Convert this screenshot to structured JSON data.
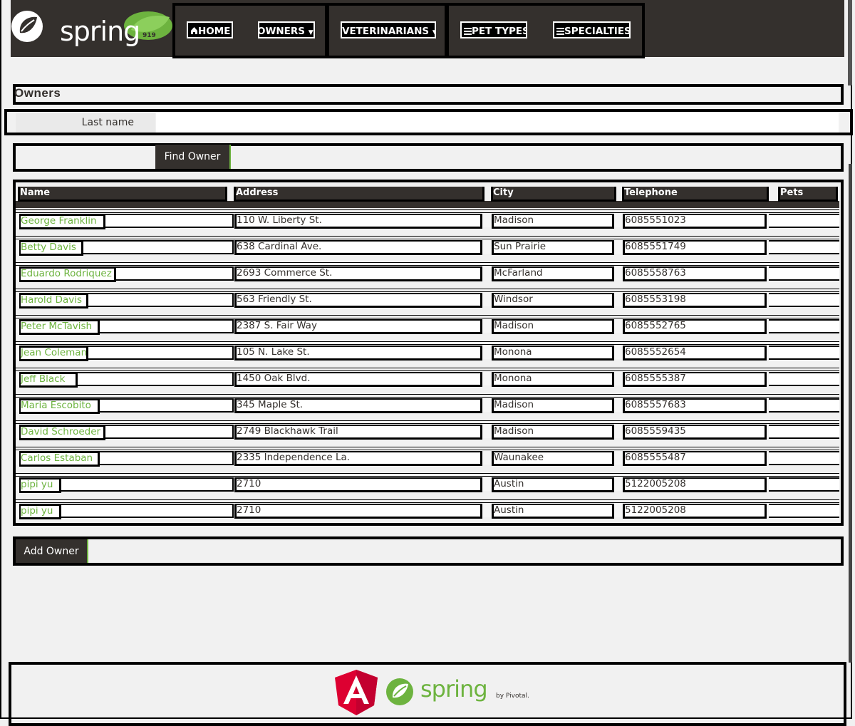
{
  "brand": {
    "name": "spring"
  },
  "nav": {
    "home": "HOME",
    "owners": "OWNERS",
    "veterinarians": "VETERINARIANS",
    "pet_types": "PET TYPES",
    "specialties": "SPECIALTIES"
  },
  "page": {
    "title": "Owners"
  },
  "search": {
    "label": "Last name",
    "value": "",
    "button": "Find Owner"
  },
  "table": {
    "headers": [
      "Name",
      "Address",
      "City",
      "Telephone",
      "Pets"
    ],
    "rows": [
      [
        "George Franklin",
        "110 W. Liberty St.",
        "Madison",
        "6085551023",
        ""
      ],
      [
        "Betty Davis",
        "638 Cardinal Ave.",
        "Sun Prairie",
        "6085551749",
        ""
      ],
      [
        "Eduardo Rodriquez",
        "2693 Commerce St.",
        "McFarland",
        "6085558763",
        ""
      ],
      [
        "Harold Davis",
        "563 Friendly St.",
        "Windsor",
        "6085553198",
        ""
      ],
      [
        "Peter McTavish",
        "2387 S. Fair Way",
        "Madison",
        "6085552765",
        ""
      ],
      [
        "Jean Coleman",
        "105 N. Lake St.",
        "Monona",
        "6085552654",
        ""
      ],
      [
        "Jeff Black",
        "1450 Oak Blvd.",
        "Monona",
        "6085555387",
        ""
      ],
      [
        "Maria Escobito",
        "345 Maple St.",
        "Madison",
        "6085557683",
        ""
      ],
      [
        "David Schroeder",
        "2749 Blackhawk Trail",
        "Madison",
        "6085559435",
        ""
      ],
      [
        "Carlos Estaban",
        "2335 Independence La.",
        "Waunakee",
        "6085555487",
        ""
      ],
      [
        "pipi yu",
        "2710",
        "Austin",
        "5122005208",
        ""
      ],
      [
        "pipi yu",
        "2710",
        "Austin",
        "5122005208",
        ""
      ]
    ]
  },
  "actions": {
    "add_owner": "Add Owner"
  },
  "footer": {
    "spring": "spring",
    "by": "by Pivotal."
  },
  "colors": {
    "header": "#34302d",
    "accent": "#6db33f",
    "angular": "#dd0031"
  },
  "icons": {
    "home": "home-icon",
    "list": "list-icon",
    "caret": "caret-down-icon"
  }
}
